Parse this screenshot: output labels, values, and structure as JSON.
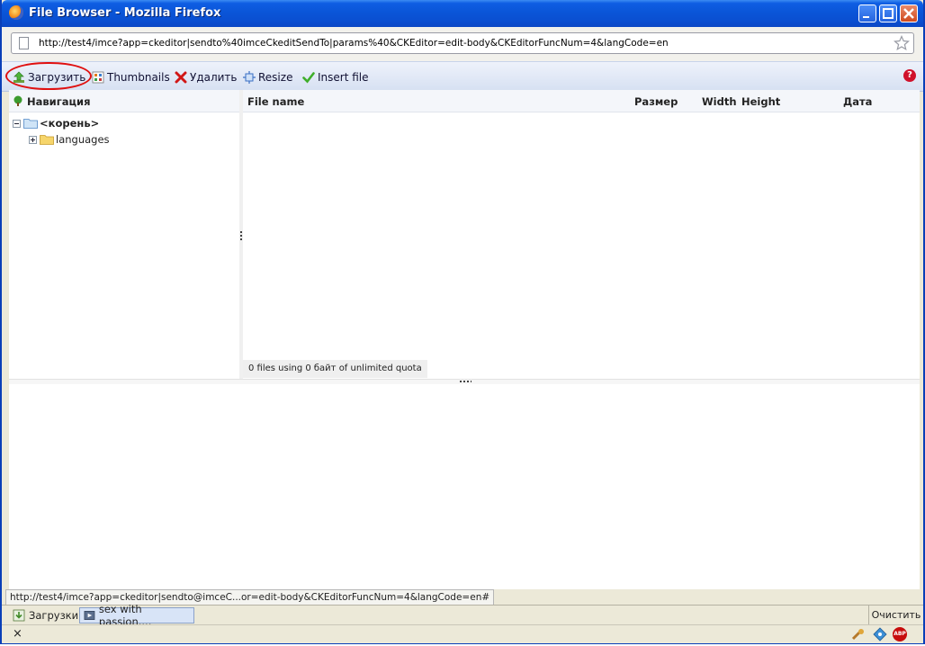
{
  "window": {
    "title": "File Browser - Mozilla Firefox",
    "url": "http://test4/imce?app=ckeditor|sendto%40imceCkeditSendTo|params%40&CKEditor=edit-body&CKEditorFuncNum=4&langCode=en"
  },
  "toolbar": {
    "upload_label": "Загрузить",
    "thumbnails_label": "Thumbnails",
    "delete_label": "Удалить",
    "resize_label": "Resize",
    "insert_label": "Insert file",
    "help_symbol": "?"
  },
  "navigation": {
    "header": "Навигация",
    "root_label": "<корень>",
    "children": [
      "languages"
    ]
  },
  "files": {
    "columns": {
      "name": "File name",
      "size": "Размер",
      "width": "Width",
      "height": "Height",
      "date": "Дата"
    },
    "status": "0 files using 0 байт of unlimited quota"
  },
  "statusbar": {
    "link": "http://test4/imce?app=ckeditor|sendto@imceC...or=edit-body&CKEditorFuncNum=4&langCode=en#",
    "downloads_label": "Загрузки",
    "download_item": "sex with passion....",
    "clear_label": "Очистить",
    "close_symbol": "×"
  },
  "colors": {
    "titlebar": "#0a55d8",
    "highlight": "#e01010",
    "help": "#d0112b"
  }
}
